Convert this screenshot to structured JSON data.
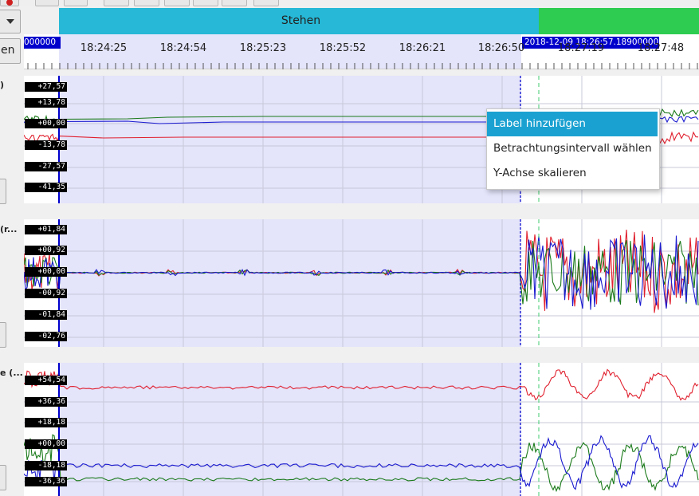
{
  "toolbar": {
    "buttons": [
      "record-icon",
      "cut-icon",
      "redo-icon",
      "blank-icon",
      "fit-icon",
      "export-icon",
      "save-icon",
      "grid-icon",
      "copy-icon"
    ]
  },
  "sidebar": {
    "dropdown_icon": "chevron-down-icon",
    "button_partial_label": "en",
    "charts": [
      {
        "label_fragment": ")"
      },
      {
        "label_fragment": "(r..."
      },
      {
        "label_fragment": "e (..."
      }
    ]
  },
  "segments": [
    {
      "label": "Stehen",
      "color": "#26b8d6"
    },
    {
      "label": "",
      "color": "#2ecc51"
    }
  ],
  "time_axis": {
    "left_cursor_fragment": "000000",
    "right_cursor_label": "2018-12-09 18:26:57.189000000",
    "ticks": [
      "18:24:25",
      "18:24:54",
      "18:25:23",
      "18:25:52",
      "18:26:21",
      "18:26:50",
      "18:27:19",
      "18:27:48"
    ]
  },
  "charts": [
    {
      "y_labels": [
        "+27,57",
        "+13,78",
        "+00,00",
        "-13,78",
        "-27,57",
        "-41,35"
      ]
    },
    {
      "y_labels": [
        "+01,84",
        "+00,92",
        "+00,00",
        "-00,92",
        "-01,84",
        "-02,76"
      ]
    },
    {
      "y_labels": [
        "+54,54",
        "+36,36",
        "+18,18",
        "+00,00",
        "-18,18",
        "-36,36"
      ]
    }
  ],
  "context_menu": {
    "items": [
      {
        "label": "Label hinzufügen",
        "selected": true
      },
      {
        "label": "Betrachtungsintervall wählen",
        "selected": false
      },
      {
        "label": "Y-Achse skalieren",
        "selected": false
      }
    ]
  },
  "colors": {
    "selection": "#e4e4fb",
    "cursor": "#0000cc",
    "series_red": "#e0202e",
    "series_green": "#1a7a1a",
    "series_blue": "#1a1ad0",
    "menu_highlight": "#1ba1d1"
  }
}
